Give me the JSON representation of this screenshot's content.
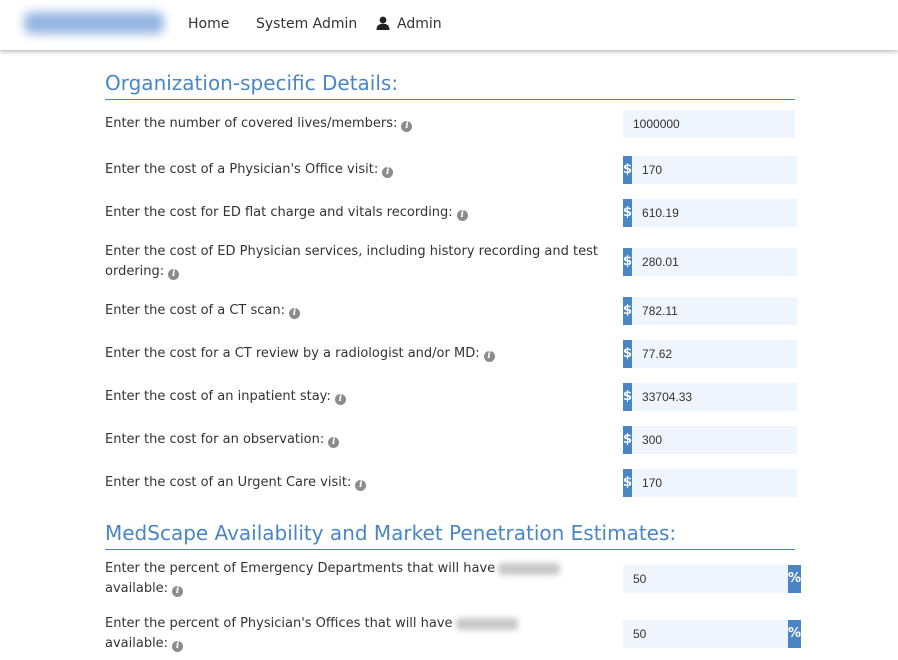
{
  "nav": {
    "links": [
      "Home",
      "System Admin"
    ],
    "admin_label": "Admin",
    "user_icon": "user-icon"
  },
  "org": {
    "title": "Organization-specific Details:",
    "rows": [
      {
        "label": "Enter the number of covered lives/members:",
        "value": "1000000",
        "prefix": ""
      },
      {
        "label": "Enter the cost of a Physician's Office visit:",
        "value": "170",
        "prefix": "$"
      },
      {
        "label": "Enter the cost for ED flat charge and vitals recording:",
        "value": "610.19",
        "prefix": "$"
      },
      {
        "label": "Enter the cost of ED Physician services, including history recording and test ordering:",
        "value": "280.01",
        "prefix": "$"
      },
      {
        "label": "Enter the cost of a CT scan:",
        "value": "782.11",
        "prefix": "$"
      },
      {
        "label": "Enter the cost for a CT review by a radiologist and/or MD:",
        "value": "77.62",
        "prefix": "$"
      },
      {
        "label": "Enter the cost of an inpatient stay:",
        "value": "33704.33",
        "prefix": "$"
      },
      {
        "label": "Enter the cost for an observation:",
        "value": "300",
        "prefix": "$"
      },
      {
        "label": "Enter the cost of an Urgent Care visit:",
        "value": "170",
        "prefix": "$"
      }
    ]
  },
  "med": {
    "title": "MedScape Availability and Market Penetration Estimates:",
    "rows": [
      {
        "label_before": "Enter the percent of Emergency Departments that will have",
        "label_after": "available:",
        "value": "50",
        "suffix": "%"
      },
      {
        "label_before": "Enter the percent of Physician's Offices that will have",
        "label_after": "available:",
        "value": "50",
        "suffix": "%"
      }
    ]
  },
  "info_icon_glyph": "i"
}
